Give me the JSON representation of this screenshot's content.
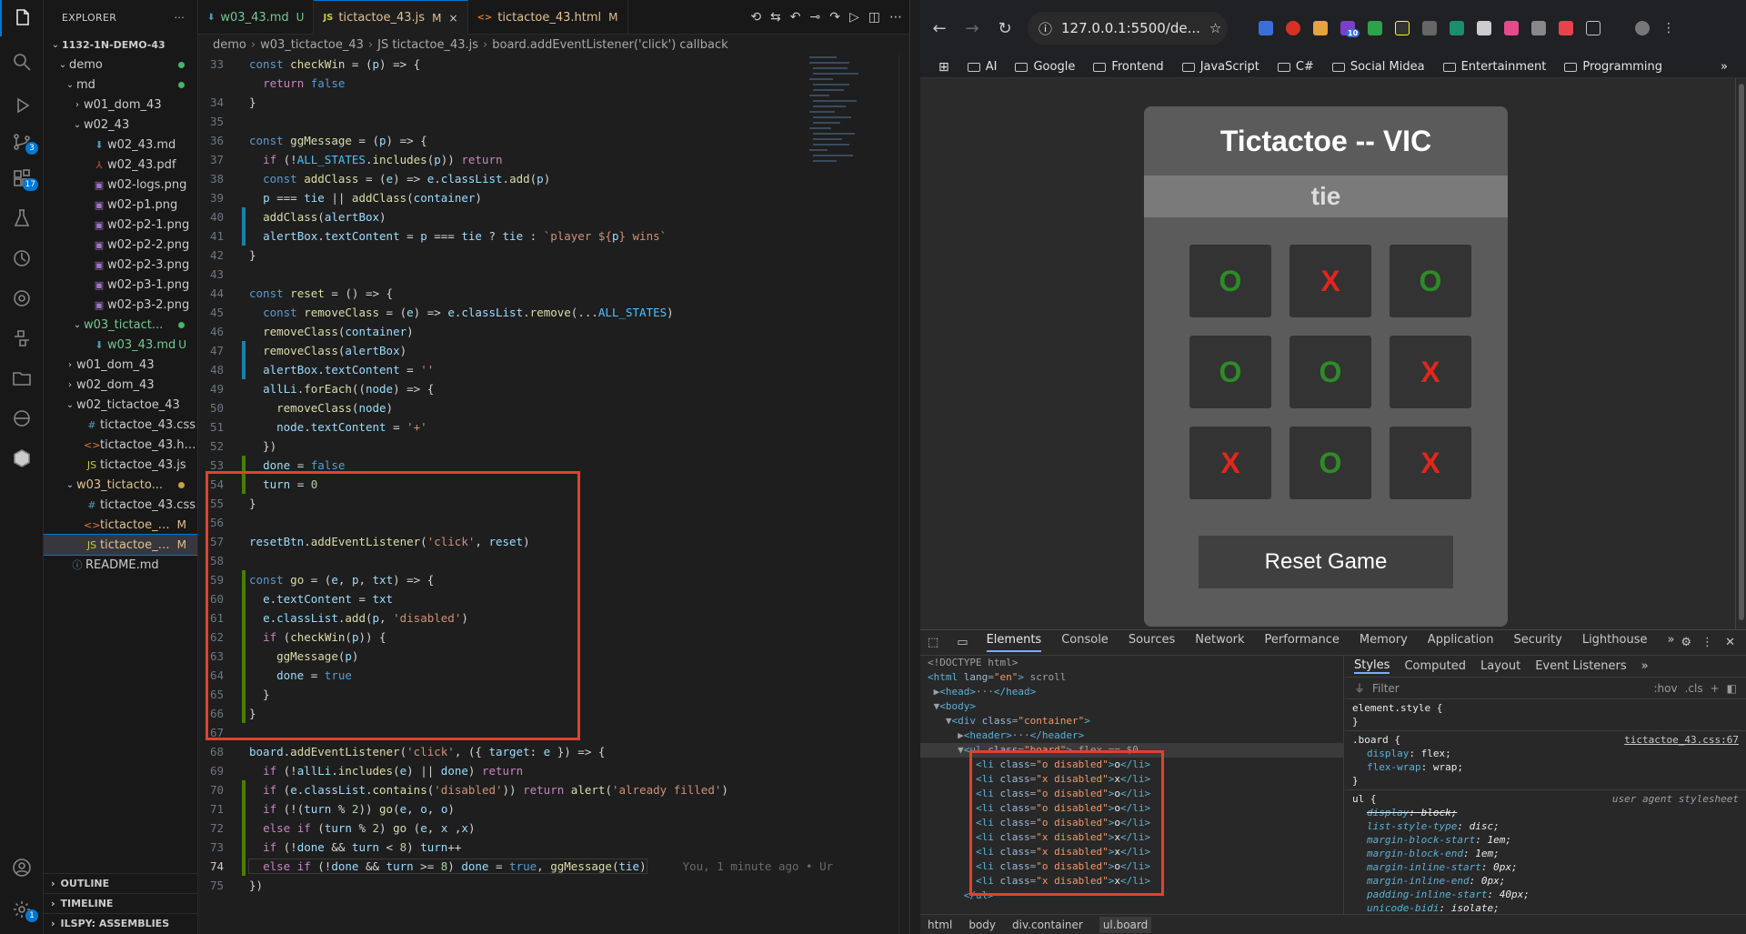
{
  "explorer": {
    "title": "EXPLORER",
    "more": "···",
    "outline": "OUTLINE",
    "timeline": "TIMELINE",
    "ilspy": "ILSPY: ASSEMBLIES",
    "tree": [
      {
        "label": "1132-1N-DEMO-43",
        "depth": 0,
        "type": "root"
      },
      {
        "label": "demo",
        "depth": 1,
        "type": "folder",
        "dot": "#47b36c"
      },
      {
        "label": "md",
        "depth": 2,
        "type": "folder",
        "dot": "#47b36c"
      },
      {
        "label": "w01_dom_43",
        "depth": 3,
        "type": "folder-closed"
      },
      {
        "label": "w02_43",
        "depth": 3,
        "type": "folder"
      },
      {
        "label": "w02_43.md",
        "depth": 4,
        "type": "md"
      },
      {
        "label": "w02_43.pdf",
        "depth": 4,
        "type": "pdf"
      },
      {
        "label": "w02-logs.png",
        "depth": 4,
        "type": "img"
      },
      {
        "label": "w02-p1.png",
        "depth": 4,
        "type": "img"
      },
      {
        "label": "w02-p2-1.png",
        "depth": 4,
        "type": "img"
      },
      {
        "label": "w02-p2-2.png",
        "depth": 4,
        "type": "img"
      },
      {
        "label": "w02-p2-3.png",
        "depth": 4,
        "type": "img"
      },
      {
        "label": "w02-p3-1.png",
        "depth": 4,
        "type": "img"
      },
      {
        "label": "w02-p3-2.png",
        "depth": 4,
        "type": "img"
      },
      {
        "label": "w03_tictact...",
        "depth": 3,
        "type": "folder",
        "dot": "#47b36c",
        "color": "#73c991"
      },
      {
        "label": "w03_43.md",
        "depth": 4,
        "type": "md",
        "stat": "U",
        "color": "#73c991"
      },
      {
        "label": "w01_dom_43",
        "depth": 2,
        "type": "folder-closed"
      },
      {
        "label": "w02_dom_43",
        "depth": 2,
        "type": "folder-closed"
      },
      {
        "label": "w02_tictactoe_43",
        "depth": 2,
        "type": "folder"
      },
      {
        "label": "tictactoe_43.css",
        "depth": 3,
        "type": "css"
      },
      {
        "label": "tictactoe_43.html",
        "depth": 3,
        "type": "html"
      },
      {
        "label": "tictactoe_43.js",
        "depth": 3,
        "type": "js"
      },
      {
        "label": "w03_tictacto...",
        "depth": 2,
        "type": "folder",
        "dot": "#c9a04a",
        "color": "#e2c08d"
      },
      {
        "label": "tictactoe_43.css",
        "depth": 3,
        "type": "css"
      },
      {
        "label": "tictactoe_43....",
        "depth": 3,
        "type": "html",
        "stat": "M",
        "color": "#e2c08d"
      },
      {
        "label": "tictactoe_43....",
        "depth": 3,
        "type": "js",
        "stat": "M",
        "color": "#e2c08d",
        "selected": true
      },
      {
        "label": "README.md",
        "depth": 1,
        "type": "info"
      }
    ]
  },
  "activity": {
    "scm_badge": "3",
    "ext_badge": "17",
    "account_badge": "1"
  },
  "tabs": [
    {
      "label": "w03_43.md",
      "icon": "⬇",
      "status": "U",
      "color": "#73c991",
      "icon_color": "#519aba"
    },
    {
      "label": "tictactoe_43.js",
      "icon": "JS",
      "status": "M",
      "close": "×",
      "active": true,
      "color": "#e2c08d",
      "icon_color": "#cbcb41"
    },
    {
      "label": "tictactoe_43.html",
      "icon": "<>",
      "status": "M",
      "color": "#e2c08d",
      "icon_color": "#e37933"
    }
  ],
  "breadcrumb": [
    "demo",
    "w03_tictactoe_43",
    "JS tictactoe_43.js",
    "board.addEventListener('click') callback"
  ],
  "code_lines": [
    {
      "n": "33",
      "g": "",
      "html": "<span class=\"kb\">const</span> <span class=\"fn\">checkWin</span> = (<span class=\"vr\">p</span>) => {"
    },
    {
      "n": "",
      "g": "",
      "html": "  <span class=\"kw\">return</span> <span class=\"kb\">false</span>"
    },
    {
      "n": "34",
      "g": "",
      "html": "}"
    },
    {
      "n": "35",
      "g": "",
      "html": ""
    },
    {
      "n": "36",
      "g": "",
      "html": "<span class=\"kb\">const</span> <span class=\"fn\">ggMessage</span> = (<span class=\"vr\">p</span>) => {"
    },
    {
      "n": "37",
      "g": "",
      "html": "  <span class=\"kw\">if</span> (!<span class=\"cn\">ALL_STATES</span>.<span class=\"fn\">includes</span>(<span class=\"vr\">p</span>)) <span class=\"kw\">return</span>"
    },
    {
      "n": "38",
      "g": "",
      "html": "  <span class=\"kb\">const</span> <span class=\"fn\">addClass</span> = (<span class=\"vr\">e</span>) => <span class=\"vr\">e</span>.<span class=\"vr\">classList</span>.<span class=\"fn\">add</span>(<span class=\"vr\">p</span>)"
    },
    {
      "n": "39",
      "g": "",
      "html": "  <span class=\"vr\">p</span> === <span class=\"vr\">tie</span> || <span class=\"fn\">addClass</span>(<span class=\"vr\">container</span>)"
    },
    {
      "n": "40",
      "g": "mod",
      "html": "  <span class=\"fn\">addClass</span>(<span class=\"vr\">alertBox</span>)"
    },
    {
      "n": "41",
      "g": "mod",
      "html": "  <span class=\"vr\">alertBox</span>.<span class=\"vr\">textContent</span> = <span class=\"vr\">p</span> === <span class=\"vr\">tie</span> ? <span class=\"vr\">tie</span> : <span class=\"st\">`player ${</span><span class=\"vr\">p</span><span class=\"st\">} wins`</span>"
    },
    {
      "n": "42",
      "g": "",
      "html": "}"
    },
    {
      "n": "43",
      "g": "",
      "html": ""
    },
    {
      "n": "44",
      "g": "",
      "html": "<span class=\"kb\">const</span> <span class=\"fn\">reset</span> = () => {"
    },
    {
      "n": "45",
      "g": "",
      "html": "  <span class=\"kb\">const</span> <span class=\"fn\">removeClass</span> = (<span class=\"vr\">e</span>) => <span class=\"vr\">e</span>.<span class=\"vr\">classList</span>.<span class=\"fn\">remove</span>(...<span class=\"cn\">ALL_STATES</span>)"
    },
    {
      "n": "46",
      "g": "",
      "html": "  <span class=\"fn\">removeClass</span>(<span class=\"vr\">container</span>)"
    },
    {
      "n": "47",
      "g": "mod",
      "html": "  <span class=\"fn\">removeClass</span>(<span class=\"vr\">alertBox</span>)"
    },
    {
      "n": "48",
      "g": "mod",
      "html": "  <span class=\"vr\">alertBox</span>.<span class=\"vr\">textContent</span> = <span class=\"st\">''</span>"
    },
    {
      "n": "49",
      "g": "",
      "html": "  <span class=\"vr\">allLi</span>.<span class=\"fn\">forEach</span>((<span class=\"vr\">node</span>) => {"
    },
    {
      "n": "50",
      "g": "",
      "html": "    <span class=\"fn\">removeClass</span>(<span class=\"vr\">node</span>)"
    },
    {
      "n": "51",
      "g": "",
      "html": "    <span class=\"vr\">node</span>.<span class=\"vr\">textContent</span> = <span class=\"st\">'+'</span>"
    },
    {
      "n": "52",
      "g": "",
      "html": "  })"
    },
    {
      "n": "53",
      "g": "add",
      "html": "  <span class=\"vr\">done</span> = <span class=\"kb\">false</span>"
    },
    {
      "n": "54",
      "g": "add",
      "html": "  <span class=\"vr\">turn</span> = <span class=\"nm\">0</span>"
    },
    {
      "n": "55",
      "g": "",
      "html": "}"
    },
    {
      "n": "56",
      "g": "",
      "html": ""
    },
    {
      "n": "57",
      "g": "",
      "html": "<span class=\"vr\">resetBtn</span>.<span class=\"fn\">addEventListener</span>(<span class=\"st\">'click'</span>, <span class=\"vr\">reset</span>)"
    },
    {
      "n": "58",
      "g": "",
      "html": ""
    },
    {
      "n": "59",
      "g": "add",
      "html": "<span class=\"kb\">const</span> <span class=\"fn\">go</span> = (<span class=\"vr\">e</span>, <span class=\"vr\">p</span>, <span class=\"vr\">txt</span>) => {"
    },
    {
      "n": "60",
      "g": "add",
      "html": "  <span class=\"vr\">e</span>.<span class=\"vr\">textContent</span> = <span class=\"vr\">txt</span>"
    },
    {
      "n": "61",
      "g": "add",
      "html": "  <span class=\"vr\">e</span>.<span class=\"vr\">classList</span>.<span class=\"fn\">add</span>(<span class=\"vr\">p</span>, <span class=\"st\">'disabled'</span>)"
    },
    {
      "n": "62",
      "g": "add",
      "html": "  <span class=\"kw\">if</span> (<span class=\"fn\">checkWin</span>(<span class=\"vr\">p</span>)) {"
    },
    {
      "n": "63",
      "g": "add",
      "html": "    <span class=\"fn\">ggMessage</span>(<span class=\"vr\">p</span>)"
    },
    {
      "n": "64",
      "g": "add",
      "html": "    <span class=\"vr\">done</span> = <span class=\"kb\">true</span>"
    },
    {
      "n": "65",
      "g": "add",
      "html": "  }"
    },
    {
      "n": "66",
      "g": "add",
      "html": "}"
    },
    {
      "n": "67",
      "g": "",
      "html": ""
    },
    {
      "n": "68",
      "g": "",
      "html": "<span class=\"vr\">board</span>.<span class=\"fn\">addEventListener</span>(<span class=\"st\">'click'</span>, ({ <span class=\"vr\">target</span>: <span class=\"vr\">e</span> }) => {"
    },
    {
      "n": "69",
      "g": "",
      "html": "  <span class=\"kw\">if</span> (!<span class=\"vr\">allLi</span>.<span class=\"fn\">includes</span>(<span class=\"vr\">e</span>) || <span class=\"vr\">done</span>) <span class=\"kw\">return</span>"
    },
    {
      "n": "70",
      "g": "add",
      "html": "  <span class=\"kw\">if</span> (<span class=\"vr\">e</span>.<span class=\"vr\">classList</span>.<span class=\"fn\">contains</span>(<span class=\"st\">'disabled'</span>)) <span class=\"kw\">return</span> <span class=\"fn\">alert</span>(<span class=\"st\">'already filled'</span>)"
    },
    {
      "n": "71",
      "g": "add",
      "html": "  <span class=\"kw\">if</span> (!(<span class=\"vr\">turn</span> % <span class=\"nm\">2</span>)) <span class=\"fn\">go</span>(<span class=\"vr\">e</span>, <span class=\"vr\">o</span>, <span class=\"vr\">o</span>)"
    },
    {
      "n": "72",
      "g": "add",
      "html": "  <span class=\"kw\">else if</span> (<span class=\"vr\">turn</span> % <span class=\"nm\">2</span>) <span class=\"fn\">go</span> (<span class=\"vr\">e</span>, <span class=\"vr\">x</span> ,<span class=\"vr\">x</span>)"
    },
    {
      "n": "73",
      "g": "add",
      "html": "  <span class=\"kw\">if</span> (!<span class=\"vr\">done</span> && <span class=\"vr\">turn</span> < <span class=\"nm\">8</span>) <span class=\"vr\">turn</span>++"
    },
    {
      "n": "74",
      "g": "add",
      "cur": true,
      "html": "  <span class=\"kw\">else if</span> (!<span class=\"vr\">done</span> && <span class=\"vr\">turn</span> >= <span class=\"nm\">8</span>) <span class=\"vr\">done</span> = <span class=\"kb\">true</span>, <span class=\"fn\">ggMessage</span>(<span class=\"vr\">tie</span>)",
      "ghost": "You, 1 minute ago • Ur"
    },
    {
      "n": "75",
      "g": "",
      "html": "})"
    }
  ],
  "browser": {
    "url": "127.0.0.1:5500/de...",
    "bookmarks": [
      "AI",
      "Google",
      "Frontend",
      "JavaScript",
      "C#",
      "Social Midea",
      "Entertainment",
      "Programming"
    ],
    "bookmarks_more": "»",
    "ext_badge": "10"
  },
  "game": {
    "title": "Tictactoe -- VIC",
    "status": "tie",
    "cells": [
      {
        "v": "O",
        "c": "o"
      },
      {
        "v": "X",
        "c": "x"
      },
      {
        "v": "O",
        "c": "o"
      },
      {
        "v": "O",
        "c": "o"
      },
      {
        "v": "O",
        "c": "o"
      },
      {
        "v": "X",
        "c": "x"
      },
      {
        "v": "X",
        "c": "x"
      },
      {
        "v": "O",
        "c": "o"
      },
      {
        "v": "X",
        "c": "x"
      }
    ],
    "reset_label": "Reset Game"
  },
  "devtools": {
    "tabs": [
      "Elements",
      "Console",
      "Sources",
      "Network",
      "Performance",
      "Memory",
      "Application",
      "Security",
      "Lighthouse",
      "»"
    ],
    "dom": [
      {
        "h": "<span class=\"cm\">&lt;!DOCTYPE html&gt;</span>"
      },
      {
        "h": "<span class=\"tg\">&lt;html</span> <span class=\"an\">lang</span>=<span class=\"av\">\"en\"</span><span class=\"tg\">&gt;</span> <span class=\"cm\">scroll</span>"
      },
      {
        "h": " ▶<span class=\"tg\">&lt;head&gt;</span><span class=\"cm\">···</span><span class=\"tg\">&lt;/head&gt;</span>"
      },
      {
        "h": " ▼<span class=\"tg\">&lt;body&gt;</span>"
      },
      {
        "h": "   ▼<span class=\"tg\">&lt;div</span> <span class=\"an\">class</span>=<span class=\"av\">\"container\"</span><span class=\"tg\">&gt;</span>"
      },
      {
        "h": "     ▶<span class=\"tg\">&lt;header&gt;</span><span class=\"cm\">···</span><span class=\"tg\">&lt;/header&gt;</span>"
      },
      {
        "h": "     ▼<span class=\"tg\">&lt;ul</span> <span class=\"an\">class</span>=<span class=\"av\">\"board\"</span><span class=\"tg\">&gt;</span> <span class=\"cm\">flex == $0</span>",
        "hl": true
      },
      {
        "h": "        <span class=\"tg\">&lt;li</span> <span class=\"an\">class</span>=<span class=\"av\">\"o disabled\"</span><span class=\"tg\">&gt;</span><span class=\"tx\">o</span><span class=\"tg\">&lt;/li&gt;</span>"
      },
      {
        "h": "        <span class=\"tg\">&lt;li</span> <span class=\"an\">class</span>=<span class=\"av\">\"x disabled\"</span><span class=\"tg\">&gt;</span><span class=\"tx\">x</span><span class=\"tg\">&lt;/li&gt;</span>"
      },
      {
        "h": "        <span class=\"tg\">&lt;li</span> <span class=\"an\">class</span>=<span class=\"av\">\"o disabled\"</span><span class=\"tg\">&gt;</span><span class=\"tx\">o</span><span class=\"tg\">&lt;/li&gt;</span>"
      },
      {
        "h": "        <span class=\"tg\">&lt;li</span> <span class=\"an\">class</span>=<span class=\"av\">\"o disabled\"</span><span class=\"tg\">&gt;</span><span class=\"tx\">o</span><span class=\"tg\">&lt;/li&gt;</span>"
      },
      {
        "h": "        <span class=\"tg\">&lt;li</span> <span class=\"an\">class</span>=<span class=\"av\">\"o disabled\"</span><span class=\"tg\">&gt;</span><span class=\"tx\">o</span><span class=\"tg\">&lt;/li&gt;</span>"
      },
      {
        "h": "        <span class=\"tg\">&lt;li</span> <span class=\"an\">class</span>=<span class=\"av\">\"x disabled\"</span><span class=\"tg\">&gt;</span><span class=\"tx\">x</span><span class=\"tg\">&lt;/li&gt;</span>"
      },
      {
        "h": "        <span class=\"tg\">&lt;li</span> <span class=\"an\">class</span>=<span class=\"av\">\"x disabled\"</span><span class=\"tg\">&gt;</span><span class=\"tx\">x</span><span class=\"tg\">&lt;/li&gt;</span>"
      },
      {
        "h": "        <span class=\"tg\">&lt;li</span> <span class=\"an\">class</span>=<span class=\"av\">\"o disabled\"</span><span class=\"tg\">&gt;</span><span class=\"tx\">o</span><span class=\"tg\">&lt;/li&gt;</span>"
      },
      {
        "h": "        <span class=\"tg\">&lt;li</span> <span class=\"an\">class</span>=<span class=\"av\">\"x disabled\"</span><span class=\"tg\">&gt;</span><span class=\"tx\">x</span><span class=\"tg\">&lt;/li&gt;</span>"
      },
      {
        "h": "      <span class=\"tg\">&lt;/ul&gt;</span>"
      }
    ],
    "styles_tabs": [
      "Styles",
      "Computed",
      "Layout",
      "Event Listeners",
      "»"
    ],
    "filter_placeholder": "Filter",
    "filter_hov": ":hov",
    "filter_cls": ".cls",
    "element_style": "element.style {",
    "board_selector": ".board {",
    "board_src": "tictactoe_43.css:67",
    "board_props": [
      [
        "display",
        "flex;"
      ],
      [
        "flex-wrap",
        "wrap;"
      ]
    ],
    "ul_selector": "ul {",
    "ul_src": "user agent stylesheet",
    "ul_props": [
      [
        "display",
        "block;",
        true
      ],
      [
        "list-style-type",
        "disc;"
      ],
      [
        "margin-block-start",
        "1em;"
      ],
      [
        "margin-block-end",
        "1em;"
      ],
      [
        "margin-inline-start",
        "0px;"
      ],
      [
        "margin-inline-end",
        "0px;"
      ],
      [
        "padding-inline-start",
        "40px;"
      ],
      [
        "unicode-bidi",
        "isolate;"
      ]
    ],
    "close_brace": "}",
    "crumbs": [
      "html",
      "body",
      "div.container",
      "ul.board"
    ]
  }
}
